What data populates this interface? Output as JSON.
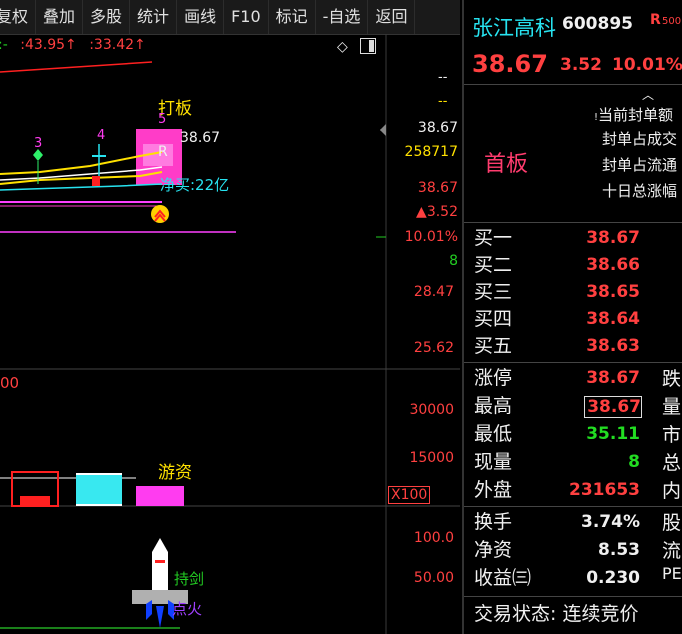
{
  "toolbar": {
    "items": [
      "复权",
      "叠加",
      "多股",
      "统计",
      "画线",
      "F10",
      "标记",
      "-自选",
      "返回"
    ]
  },
  "chart": {
    "top_info": {
      "prefix": ":-",
      "v1": ":43.95",
      "v2": ":33.42"
    },
    "labels": {
      "daban": "打板",
      "wave3": "3",
      "wave4": "4",
      "wave5": "5",
      "r_mark": "R",
      "jingmai": "净买:22亿",
      "shang": "上",
      "youzi": "游资",
      "hold": "持",
      "jian": "剑",
      "dianhuo": "点火"
    },
    "price_axis": {
      "current": "38.67",
      "volume": "258717",
      "close": "38.67",
      "change": "▲3.52",
      "pct": "10.01%",
      "count": "8",
      "p1": "28.47",
      "p2": "25.62",
      "dash1": "--",
      "dash2": "--"
    },
    "vol_axis": {
      "left": "00",
      "v1": "30000",
      "v2": "15000",
      "unit": "X100"
    },
    "ind_axis": {
      "v1": "100.0",
      "v2": "50.00"
    }
  },
  "stock": {
    "name": "张江高科",
    "code": "600895",
    "tag": "R",
    "tag2": "500",
    "price": "38.67",
    "change": "3.52",
    "pct": "10.01%",
    "board": "首板",
    "notes": [
      "当前封单额",
      "封单占成交",
      "封单占流通",
      "十日总涨幅"
    ]
  },
  "bids": [
    {
      "label": "买一",
      "price": "38.67"
    },
    {
      "label": "买二",
      "price": "38.66"
    },
    {
      "label": "买三",
      "price": "38.65"
    },
    {
      "label": "买四",
      "price": "38.64"
    },
    {
      "label": "买五",
      "price": "38.63"
    }
  ],
  "quote": [
    {
      "label": "涨停",
      "value": "38.67",
      "ext": "跌",
      "color": "#ff4040"
    },
    {
      "label": "最高",
      "value": "38.67",
      "ext": "量",
      "color": "#ff4040"
    },
    {
      "label": "最低",
      "value": "35.11",
      "ext": "市",
      "color": "#22dd22"
    },
    {
      "label": "现量",
      "value": "8",
      "ext": "总",
      "color": "#22dd22"
    },
    {
      "label": "外盘",
      "value": "231653",
      "ext": "内",
      "color": "#ff4040"
    }
  ],
  "fund": [
    {
      "label": "换手",
      "value": "3.74%",
      "ext": "股"
    },
    {
      "label": "净资",
      "value": "8.53",
      "ext": "流"
    },
    {
      "label": "收益㈢",
      "value": "0.230",
      "ext": "PE"
    }
  ],
  "status": "交易状态: 连续竞价",
  "colors": {
    "up": "#ff4040",
    "down": "#22dd22",
    "accent": "#27e3f0"
  }
}
